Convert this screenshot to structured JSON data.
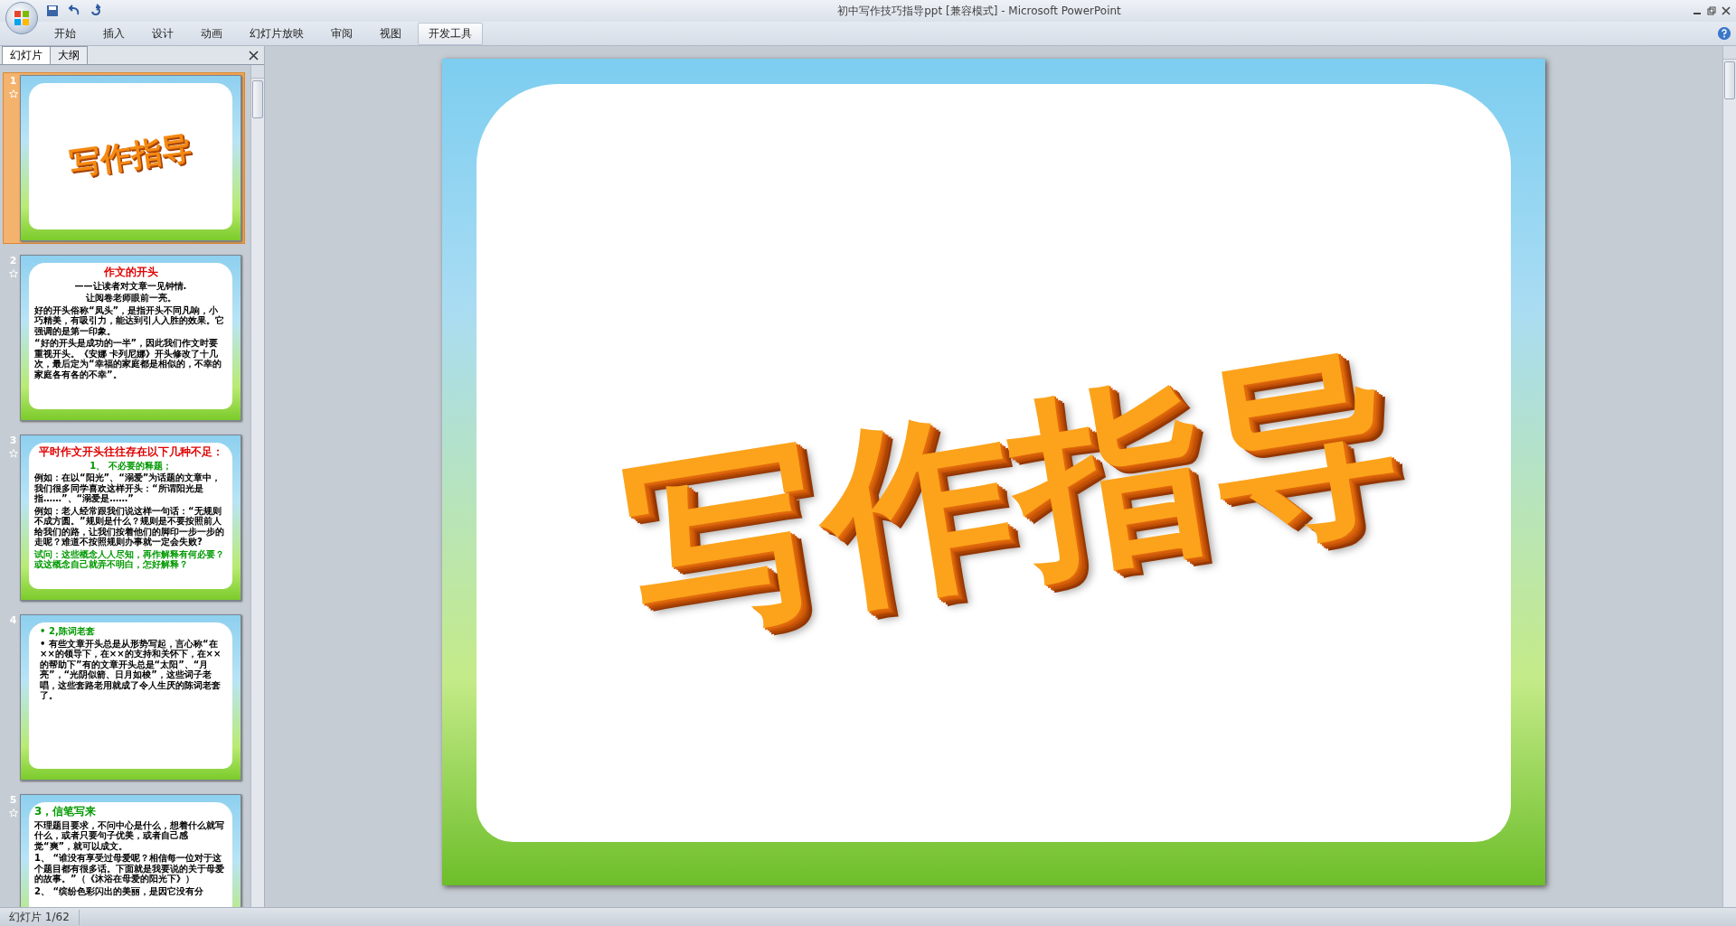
{
  "window": {
    "title": "初中写作技巧指导ppt [兼容模式] - Microsoft PowerPoint"
  },
  "ribbon_tabs": [
    {
      "label": "开始",
      "selected": false
    },
    {
      "label": "插入",
      "selected": false
    },
    {
      "label": "设计",
      "selected": false
    },
    {
      "label": "动画",
      "selected": false
    },
    {
      "label": "幻灯片放映",
      "selected": false
    },
    {
      "label": "审阅",
      "selected": false
    },
    {
      "label": "视图",
      "selected": false
    },
    {
      "label": "开发工具",
      "selected": true
    }
  ],
  "pane_tabs": [
    {
      "label": "幻灯片",
      "selected": true
    },
    {
      "label": "大纲",
      "selected": false
    }
  ],
  "slides": [
    {
      "number": "1",
      "selected": true,
      "animated": true,
      "kind": "title",
      "title": "写作指导"
    },
    {
      "number": "2",
      "selected": false,
      "animated": true,
      "kind": "text",
      "blocks": [
        {
          "kind": "heading",
          "color": "#e00000",
          "text": "作文的开头"
        },
        {
          "kind": "sub",
          "color": "#000000",
          "text": "——让读者对文章一见钟情."
        },
        {
          "kind": "sub",
          "color": "#000000",
          "text": "让阅卷老师眼前一亮。"
        },
        {
          "kind": "para",
          "color": "#000000",
          "text": "好的开头俗称“凤头”，是指开头不同凡响，小巧精美，有吸引力，能达到引人入胜的效果。它强调的是第一印象。"
        },
        {
          "kind": "para",
          "color": "#000000",
          "text": "“好的开头是成功的一半”，因此我们作文时要重视开头。《安娜 卡列尼娜》开头修改了十几次，最后定为“幸福的家庭都是相似的，不幸的家庭各有各的不幸”。"
        }
      ]
    },
    {
      "number": "3",
      "selected": false,
      "animated": true,
      "kind": "text",
      "blocks": [
        {
          "kind": "heading",
          "color": "#e00000",
          "text": "平时作文开头往往存在以下几种不足："
        },
        {
          "kind": "sub",
          "color": "#009900",
          "text": "1、 不必要的释题；"
        },
        {
          "kind": "para",
          "color": "#000000",
          "text": "例如：在以“阳光”、“溺爱”为话题的文章中，我们很多同学喜欢这样开头：“所谓阳光是指……”、“溺爱是……”"
        },
        {
          "kind": "para",
          "color": "#000000",
          "text": "例如：老人经常跟我们说这样一句话：“无规则不成方圆。”规则是什么？规则是不要按照前人给我们的路，让我们按着他们的脚印一步一步的走呢？难道不按照规则办事就一定会失败?"
        },
        {
          "kind": "para",
          "color": "#009900",
          "text": "试问：这些概念人人尽知，再作解释有何必要？或这概念自己就弄不明白，怎好解释？"
        }
      ]
    },
    {
      "number": "4",
      "selected": false,
      "animated": false,
      "kind": "text",
      "blocks": [
        {
          "kind": "bullet",
          "color": "#009900",
          "marker": "•",
          "text": "2,陈词老套"
        },
        {
          "kind": "bullet",
          "color": "#000000",
          "marker": "•",
          "text": "有些文章开头总是从形势写起，言心称“在××的领导下，在××的支持和关怀下，在××的帮助下”有的文章开头总是“太阳”、“月亮”，“光阴似箭、日月如梭”，这些词子老唱，这些套路老用就成了令人生厌的陈词老套了。"
        }
      ]
    },
    {
      "number": "5",
      "selected": false,
      "animated": true,
      "kind": "text",
      "blocks": [
        {
          "kind": "heading",
          "color": "#009900",
          "text": "3，信笔写来"
        },
        {
          "kind": "para",
          "color": "#000000",
          "text": "不理题目要求，不问中心是什么，想着什么就写什么，或者只要句子优美，或者自己感觉“爽”，就可以成文。"
        },
        {
          "kind": "para",
          "color": "#000000",
          "text": "1、 “谁没有享受过母爱呢？相信每一位对于这个题目都有很多话。下面就是我要说的关于母爱的故事。”（《沐浴在母爱的阳光下》）"
        },
        {
          "kind": "para",
          "color": "#000000",
          "text": "2、 “缤纷色彩闪出的美丽，是因它没有分"
        }
      ]
    }
  ],
  "main_slide": {
    "title": "写作指导"
  },
  "status_bar": {
    "slide_indicator": "幻灯片 1/62"
  }
}
